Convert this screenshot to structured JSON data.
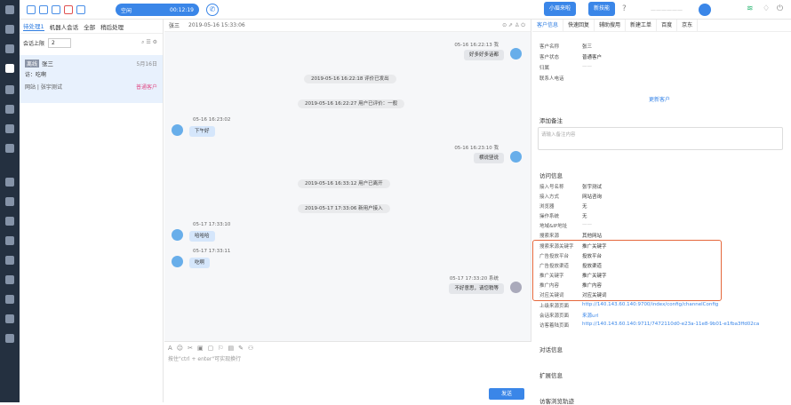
{
  "topbar": {
    "status": "空闲",
    "timer": "00:12:19",
    "btn_incoming": "小眉来啦",
    "btn_new": "新技能",
    "user": "——————"
  },
  "left": {
    "tabs": [
      "待处理1",
      "机器人会话",
      "全部",
      "稍后处理"
    ],
    "filter_label": "会话上限",
    "filter_value": "2",
    "conv": {
      "badge": "离线",
      "name": "张三",
      "date": "5月16日",
      "msg": "访：吃啊",
      "source": "网站 | 张宇测试",
      "tag": "普通客户"
    }
  },
  "chat": {
    "title": "张三",
    "time": "2019-05-16 15:33:06",
    "msgs": [
      {
        "kind": "right",
        "time": "05-16 16:22:13 我",
        "text": "好多好多话都"
      },
      {
        "kind": "sys",
        "text": "2019-05-16 16:22:18 评价已发出"
      },
      {
        "kind": "sys",
        "text": "2019-05-16 16:22:27 用户已评价：一般"
      },
      {
        "kind": "left",
        "time": "05-16 16:23:02",
        "text": "下午好"
      },
      {
        "kind": "right",
        "time": "05-16 16:23:10 我",
        "text": "横说竖说"
      },
      {
        "kind": "sys",
        "text": "2019-05-16 16:33:12 用户已离开"
      },
      {
        "kind": "sys",
        "text": "2019-05-17 17:33:06 新用户接入"
      },
      {
        "kind": "left",
        "time": "05-17 17:33:10",
        "text": "哈哈哈"
      },
      {
        "kind": "left",
        "time": "05-17 17:33:11",
        "text": "吃啊"
      },
      {
        "kind": "right",
        "time": "05-17 17:33:20 系统",
        "text": "不好意思，请您稍等"
      }
    ],
    "input_placeholder": "按住\"ctrl + enter\"可实现换行",
    "send": "发送"
  },
  "right": {
    "tabs": [
      "客户信息",
      "快速回复",
      "辅助搜用",
      "新建工单",
      "百度",
      "京东"
    ],
    "info": [
      [
        "客户名称",
        "张三"
      ],
      [
        "客户状态",
        "普通客户"
      ],
      [
        "归属",
        "——"
      ],
      [
        "联系人电话",
        ""
      ]
    ],
    "more": "更新客户",
    "notes_title": "添加备注",
    "notes_placeholder": "请输入备注内容",
    "visit_title": "访问信息",
    "visit": [
      [
        "接入号名称",
        "张宇测试"
      ],
      [
        "接入方式",
        "网站咨询"
      ],
      [
        "浏览器",
        "无"
      ],
      [
        "操作系统",
        "无"
      ],
      [
        "地域&IP地址",
        "——"
      ],
      [
        "搜索来源",
        "其他网站"
      ]
    ],
    "highlight": [
      [
        "搜索来源关键字",
        "推广关键字"
      ],
      [
        "广告投放平台",
        "投放平台"
      ],
      [
        "广告投放渠道",
        "投放渠道"
      ],
      [
        "推广关键字",
        "推广关键字"
      ],
      [
        "推广内容",
        "推广内容"
      ],
      [
        "对应关键词",
        "对应关键词"
      ]
    ],
    "links": [
      [
        "上级来源页面",
        "http://140.143.60.140:9700/index/config/channelConfig"
      ],
      [
        "会话来源页面",
        "来源url"
      ],
      [
        "访客着陆页面",
        "http://140.143.60.140:9711/7472110d0-e23a-11e8-9b01-e1fba3ffd02ca"
      ]
    ],
    "sections": [
      "对话信息",
      "扩展信息",
      "访客浏览轨迹"
    ]
  }
}
